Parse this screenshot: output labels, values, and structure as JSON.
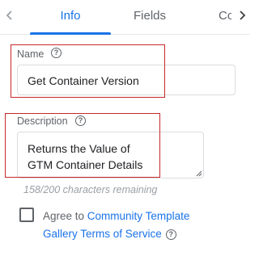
{
  "tabs": [
    {
      "label": "Info",
      "active": true
    },
    {
      "label": "Fields",
      "active": false
    },
    {
      "label": "Consent",
      "active": false
    }
  ],
  "name_field": {
    "label": "Name",
    "value": "Get Container Version"
  },
  "description_field": {
    "label": "Description",
    "value": "Returns the Value of GTM Container Details"
  },
  "char_counter": "158/200 characters remaining",
  "agree": {
    "prefix": "Agree to ",
    "link_text": "Community Template Gallery Terms of Service",
    "checked": false
  },
  "icons": {
    "tab_prev": "chevron-left-icon",
    "tab_next": "chevron-right-icon",
    "help": "help-circle-icon"
  },
  "colors": {
    "accent": "#1a73e8",
    "highlight_box": "#c62828"
  }
}
